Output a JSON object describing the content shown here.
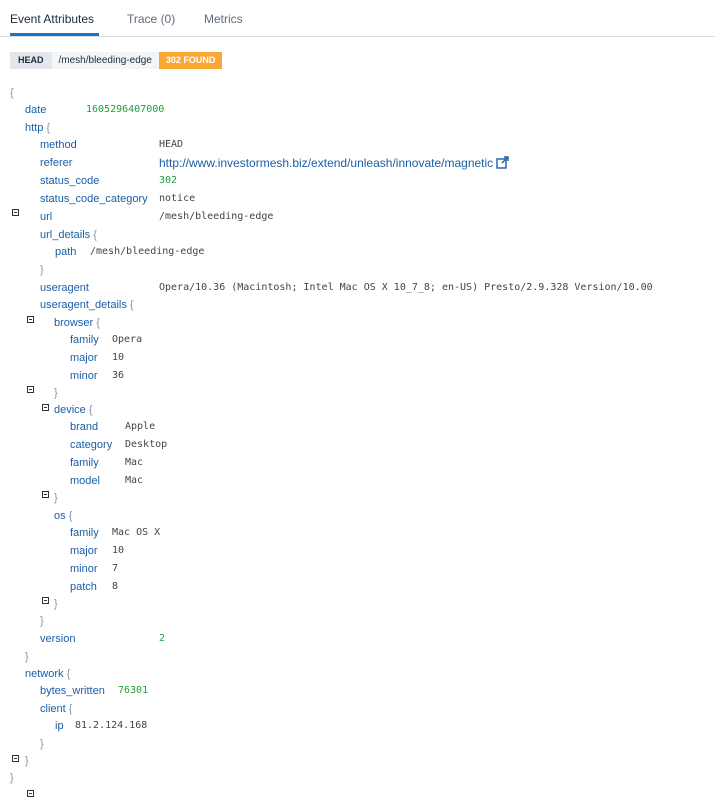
{
  "tabs": [
    {
      "label": "Event Attributes",
      "active": true
    },
    {
      "label": "Trace (0)",
      "active": false
    },
    {
      "label": "Metrics",
      "active": false
    }
  ],
  "request": {
    "method": "HEAD",
    "path": "/mesh/bleeding-edge",
    "status": "302 FOUND"
  },
  "colors": {
    "accent": "#1a73c5",
    "status_badge": "#f9a836",
    "key": "#1a5ea8",
    "number": "#1fa03b"
  },
  "icons": {
    "collapse": "minus-square-icon",
    "external_link": "external-link-icon"
  },
  "json": {
    "open": "{",
    "close": "}",
    "date": {
      "key": "date",
      "value": "1605296407000"
    },
    "http": {
      "key": "http",
      "method": {
        "key": "method",
        "value": "HEAD"
      },
      "referer": {
        "key": "referer",
        "value": "http://www.investormesh.biz/extend/unleash/innovate/magnetic"
      },
      "status_code": {
        "key": "status_code",
        "value": "302"
      },
      "status_code_category": {
        "key": "status_code_category",
        "value": "notice"
      },
      "url": {
        "key": "url",
        "value": "/mesh/bleeding-edge"
      },
      "url_details": {
        "key": "url_details",
        "path": {
          "key": "path",
          "value": "/mesh/bleeding-edge"
        }
      },
      "useragent": {
        "key": "useragent",
        "value": "Opera/10.36 (Macintosh; Intel Mac OS X 10_7_8; en-US) Presto/2.9.328 Version/10.00"
      },
      "useragent_details": {
        "key": "useragent_details",
        "browser": {
          "key": "browser",
          "family": {
            "key": "family",
            "value": "Opera"
          },
          "major": {
            "key": "major",
            "value": "10"
          },
          "minor": {
            "key": "minor",
            "value": "36"
          }
        },
        "device": {
          "key": "device",
          "brand": {
            "key": "brand",
            "value": "Apple"
          },
          "category": {
            "key": "category",
            "value": "Desktop"
          },
          "family": {
            "key": "family",
            "value": "Mac"
          },
          "model": {
            "key": "model",
            "value": "Mac"
          }
        },
        "os": {
          "key": "os",
          "family": {
            "key": "family",
            "value": "Mac OS X"
          },
          "major": {
            "key": "major",
            "value": "10"
          },
          "minor": {
            "key": "minor",
            "value": "7"
          },
          "patch": {
            "key": "patch",
            "value": "8"
          }
        }
      },
      "version": {
        "key": "version",
        "value": "2"
      }
    },
    "network": {
      "key": "network",
      "bytes_written": {
        "key": "bytes_written",
        "value": "76301"
      },
      "client": {
        "key": "client",
        "ip": {
          "key": "ip",
          "value": "81.2.124.168"
        }
      }
    }
  }
}
